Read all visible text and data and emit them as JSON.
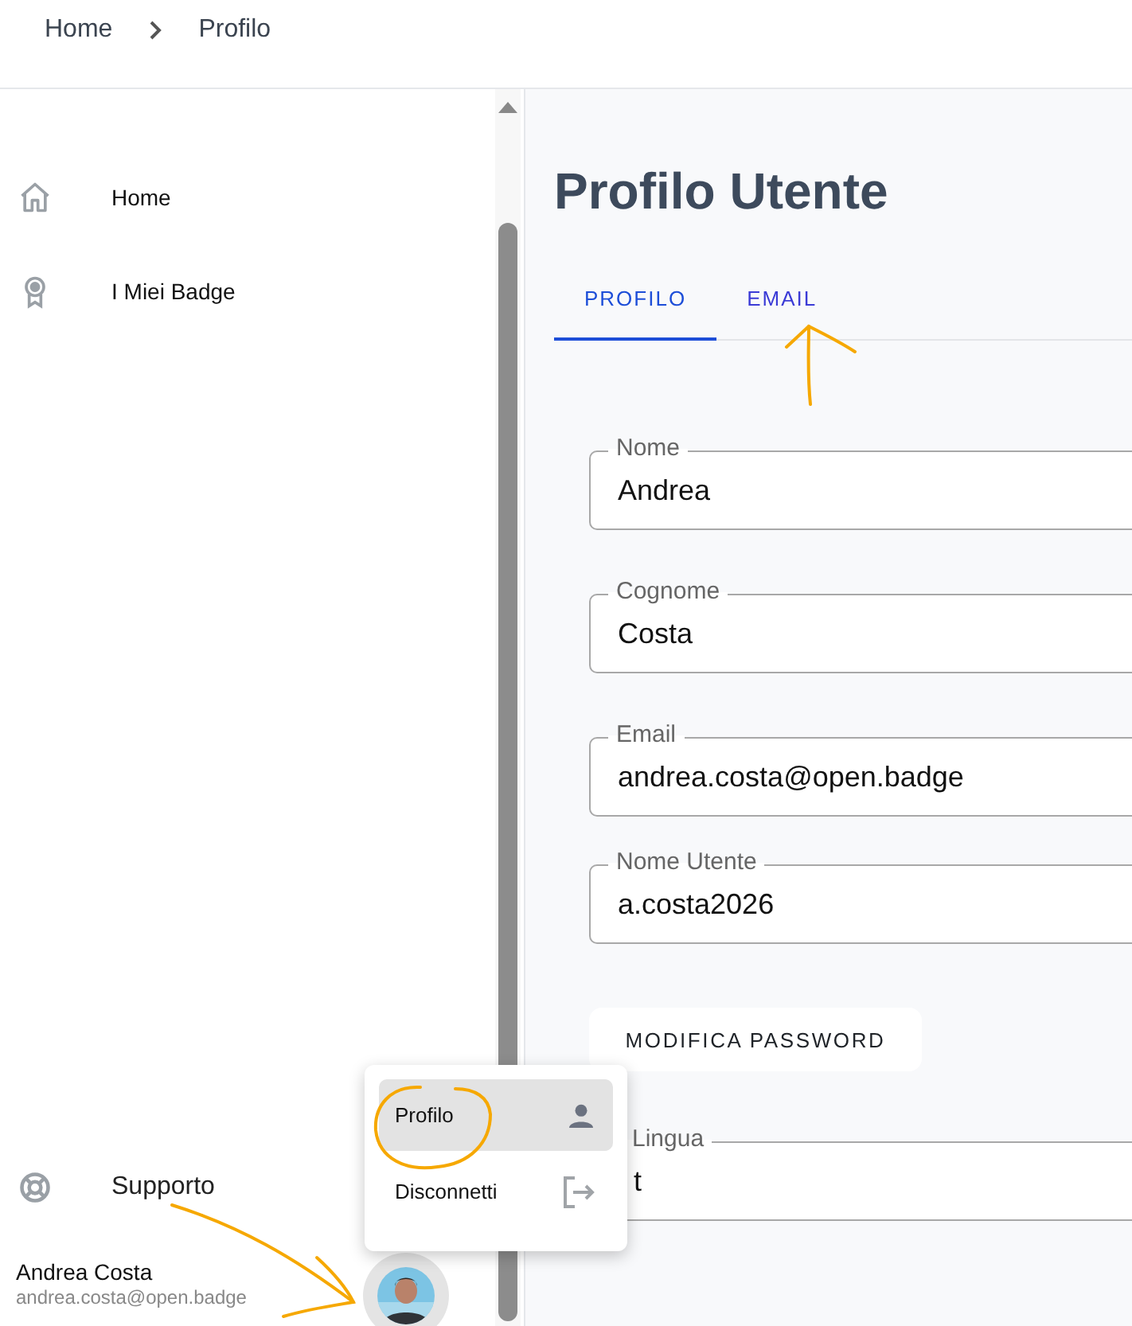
{
  "breadcrumb": [
    {
      "label": "Home"
    },
    {
      "label": "Profilo"
    }
  ],
  "sidebar": {
    "items": [
      {
        "label": "Home",
        "kind": "home"
      },
      {
        "label": "I Miei Badge",
        "kind": "badge"
      }
    ],
    "footer_items": [
      {
        "label": "Supporto",
        "kind": "support"
      }
    ],
    "user": {
      "name": "Andrea Costa",
      "email": "andrea.costa@open.badge"
    }
  },
  "main": {
    "title": "Profilo Utente",
    "tabs": [
      {
        "label": "PROFILO",
        "selected": true
      },
      {
        "label": "EMAIL",
        "selected": false
      }
    ],
    "fields": [
      {
        "label": "Nome",
        "value": "Andrea"
      },
      {
        "label": "Cognome",
        "value": "Costa"
      },
      {
        "label": "Email",
        "value": "andrea.costa@open.badge"
      },
      {
        "label": "Nome Utente",
        "value": "a.costa2026"
      }
    ],
    "button": "MODIFICA PASSWORD",
    "language_field": {
      "label": "Lingua",
      "value": "t"
    }
  },
  "user_menu": {
    "items": [
      {
        "label": "Profilo",
        "kind": "profile",
        "selected": true
      },
      {
        "label": "Disconnetti",
        "kind": "logout",
        "selected": false
      }
    ]
  }
}
